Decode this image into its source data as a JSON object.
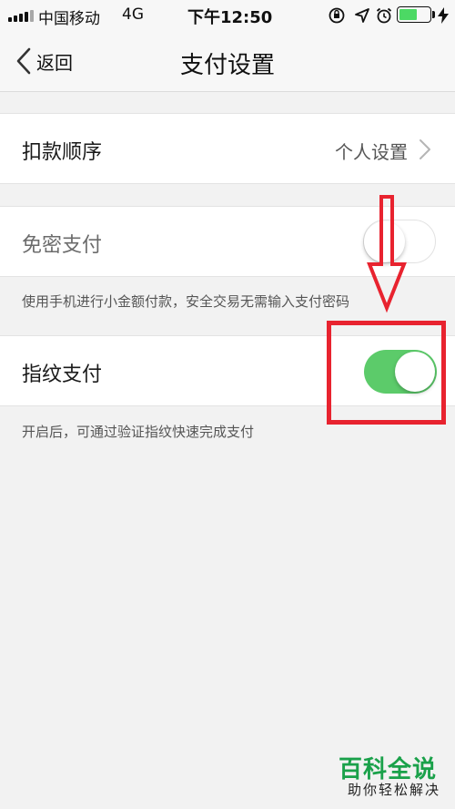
{
  "status_bar": {
    "carrier": "中国移动",
    "network": "4G",
    "time": "下午12:50",
    "battery_level": 0.6,
    "battery_color": "#4cd964"
  },
  "nav": {
    "back_label": "返回",
    "title": "支付设置"
  },
  "deduction_order": {
    "label": "扣款顺序",
    "value": "个人设置"
  },
  "password_free": {
    "label": "免密支付",
    "enabled": false,
    "hint": "使用手机进行小金额付款，安全交易无需输入支付密码"
  },
  "fingerprint": {
    "label": "指纹支付",
    "enabled": true,
    "hint": "开启后，可通过验证指纹快速完成支付",
    "switch_color": "#5ccb6a"
  },
  "annotation": {
    "color": "#e8232f"
  },
  "watermark": {
    "title": "百科全说",
    "subtitle": "助你轻松解决",
    "color": "#1aa14a"
  }
}
